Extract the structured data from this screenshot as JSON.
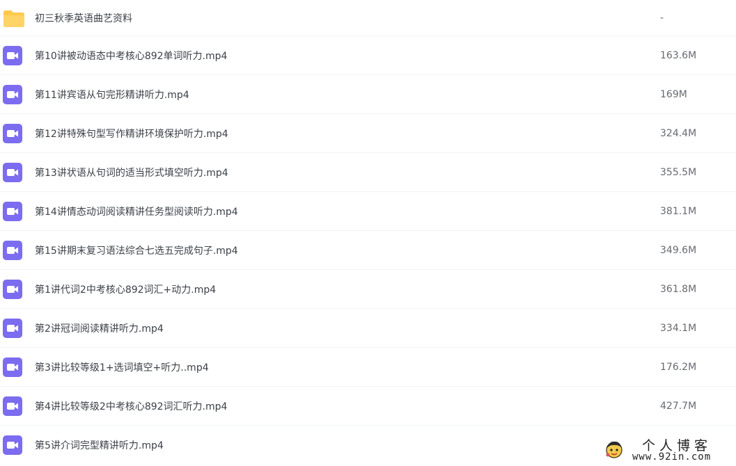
{
  "files": [
    {
      "name": "初三秋季英语曲艺资料",
      "size": "-",
      "type": "folder"
    },
    {
      "name": "第10讲被动语态中考核心892单词听力.mp4",
      "size": "163.6M",
      "type": "video"
    },
    {
      "name": "第11讲宾语从句完形精讲听力.mp4",
      "size": "169M",
      "type": "video"
    },
    {
      "name": "第12讲特殊句型写作精讲环境保护听力.mp4",
      "size": "324.4M",
      "type": "video"
    },
    {
      "name": "第13讲状语从句词的适当形式填空听力.mp4",
      "size": "355.5M",
      "type": "video"
    },
    {
      "name": "第14讲情态动词阅读精讲任务型阅读听力.mp4",
      "size": "381.1M",
      "type": "video"
    },
    {
      "name": "第15讲期末复习语法综合七选五完成句子.mp4",
      "size": "349.6M",
      "type": "video"
    },
    {
      "name": "第1讲代词2中考核心892词汇+动力.mp4",
      "size": "361.8M",
      "type": "video"
    },
    {
      "name": "第2讲冠词阅读精讲听力.mp4",
      "size": "334.1M",
      "type": "video"
    },
    {
      "name": "第3讲比较等级1+选词填空+听力..mp4",
      "size": "176.2M",
      "type": "video"
    },
    {
      "name": "第4讲比较等级2中考核心892词汇听力.mp4",
      "size": "427.7M",
      "type": "video"
    },
    {
      "name": "第5讲介词完型精讲听力.mp4",
      "size": "",
      "type": "video"
    }
  ],
  "watermark": {
    "title": "个人博客",
    "url": "www.92in.com"
  },
  "colors": {
    "folder": "#ffc94d",
    "video": "#7b6cf0",
    "text": "#3b4047",
    "size": "#666a70"
  }
}
